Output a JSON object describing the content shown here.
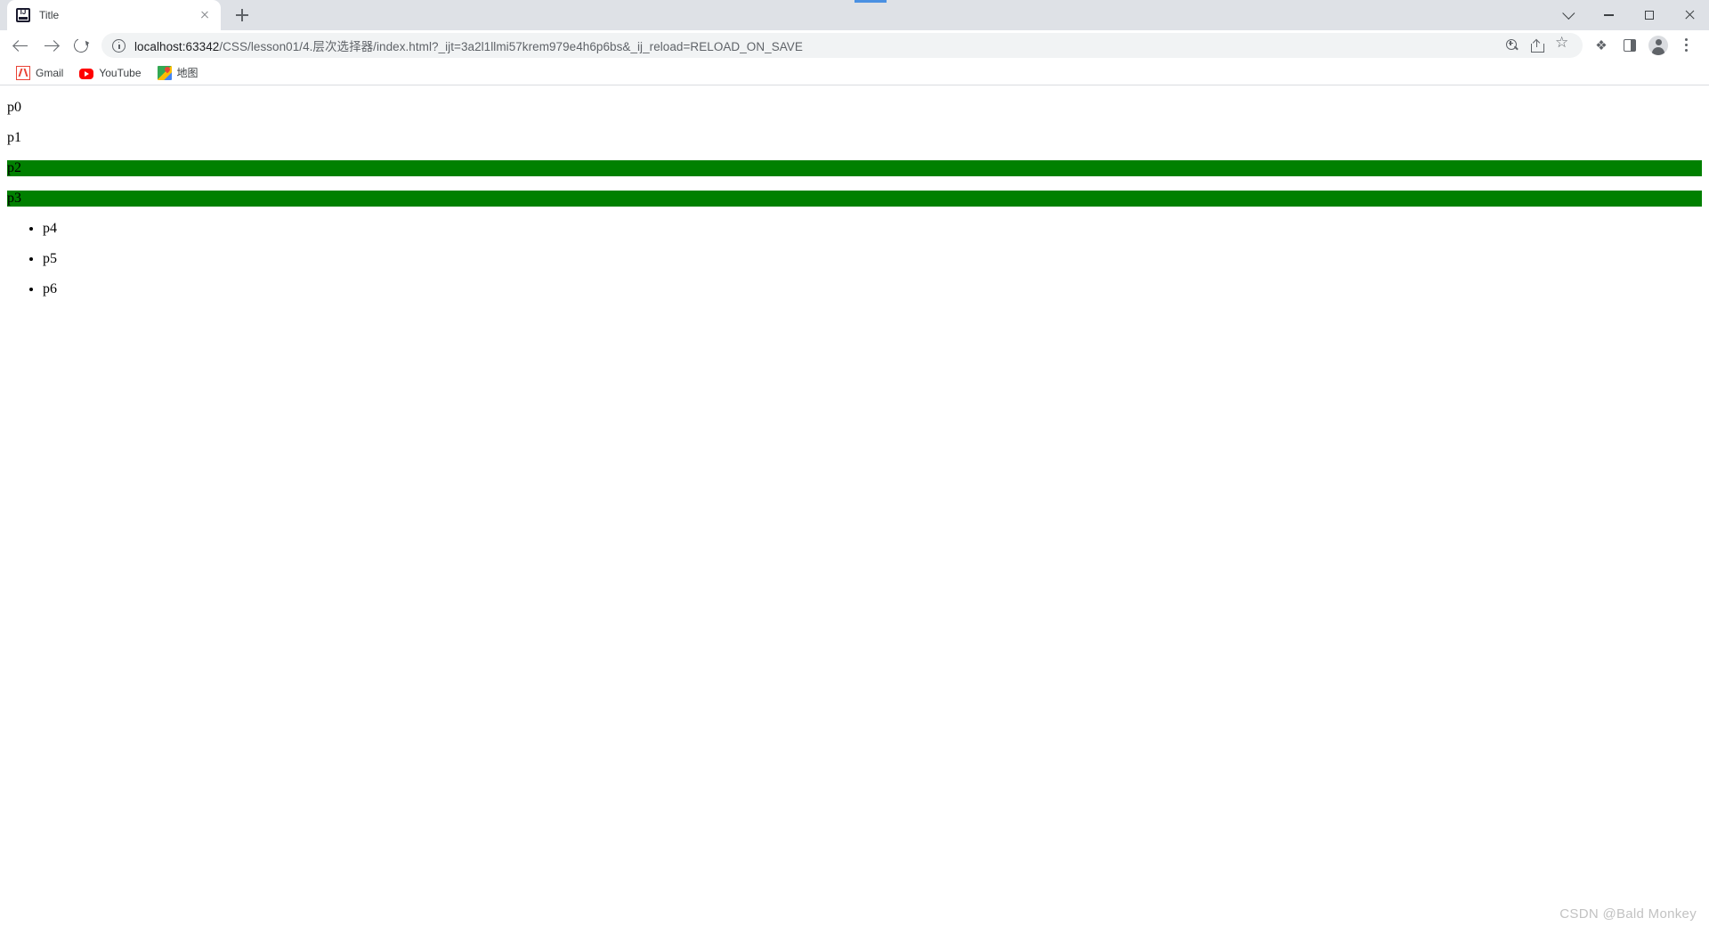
{
  "window": {
    "controls": {
      "more_label": "⌄",
      "minimize_label": "—",
      "maximize_label": "□",
      "close_label": "✕"
    }
  },
  "tabstrip": {
    "tabs": [
      {
        "title": "Title",
        "favicon": "intellij-idea-icon",
        "close_label": "✕"
      }
    ],
    "new_tab_label": "+"
  },
  "navigation": {
    "back_label": "←",
    "forward_label": "→",
    "reload_label": "↻"
  },
  "omnibox": {
    "site_info_icon": "info-circle-icon",
    "url_host": "localhost:63342",
    "url_path": "/CSS/lesson01/4.层次选择器/index.html?_ijt=3a2l1llmi57krem979e4h6p6bs&_ij_reload=RELOAD_ON_SAVE",
    "url_full": "localhost:63342/CSS/lesson01/4.层次选择器/index.html?_ijt=3a2l1llmi57krem979e4h6p6bs&_ij_reload=RELOAD_ON_SAVE",
    "actions": [
      {
        "name": "zoom-icon"
      },
      {
        "name": "share-icon"
      },
      {
        "name": "bookmark-star-icon"
      }
    ]
  },
  "toolbar_right": {
    "items": [
      {
        "name": "extensions-puzzle-icon",
        "glyph": "❖"
      },
      {
        "name": "side-panel-icon"
      },
      {
        "name": "profile-avatar-icon"
      },
      {
        "name": "more-menu-icon"
      }
    ]
  },
  "bookmarks": {
    "items": [
      {
        "label": "Gmail",
        "icon": "gmail-icon"
      },
      {
        "label": "YouTube",
        "icon": "youtube-icon"
      },
      {
        "label": "地图",
        "icon": "google-maps-icon"
      }
    ]
  },
  "page_content": {
    "paragraphs": [
      {
        "text": "p0",
        "highlighted": false
      },
      {
        "text": "p1",
        "highlighted": false
      },
      {
        "text": "p2",
        "highlighted": true
      },
      {
        "text": "p3",
        "highlighted": true
      }
    ],
    "list_items": [
      {
        "text": "p4"
      },
      {
        "text": "p5"
      },
      {
        "text": "p6"
      }
    ],
    "highlight_color": "#008000",
    "text_color": "#000000",
    "background_color": "#ffffff"
  },
  "watermark": {
    "text": "CSDN @Bald Monkey"
  }
}
